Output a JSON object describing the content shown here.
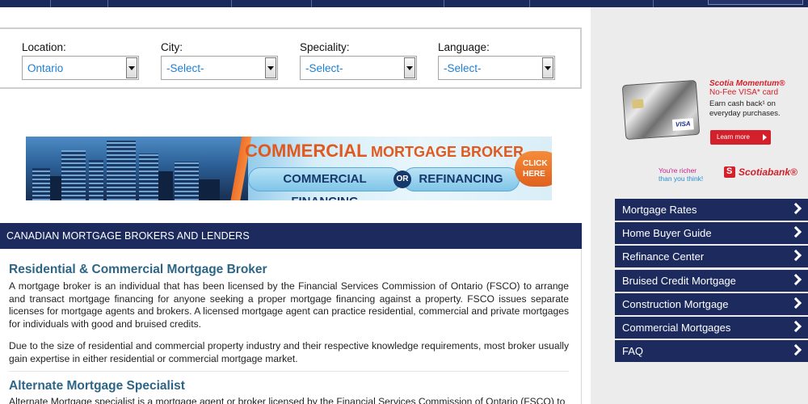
{
  "filters": {
    "location": {
      "label": "Location:",
      "value": "Ontario"
    },
    "city": {
      "label": "City:",
      "value": "-Select-"
    },
    "speciality": {
      "label": "Speciality:",
      "value": "-Select-"
    },
    "language": {
      "label": "Language:",
      "value": "-Select-"
    }
  },
  "banner": {
    "title_big": "COMMERCIAL",
    "title_small": "MORTGAGE BROKER",
    "left_pill": "COMMERCIAL FINANCING",
    "or": "OR",
    "right_pill": "REFINANCING",
    "cta_line1": "CLICK",
    "cta_line2": "HERE"
  },
  "section": {
    "title": "CANADIAN MORTGAGE BROKERS AND LENDERS"
  },
  "content": {
    "h1": "Residential & Commercial Mortgage Broker",
    "p1": "A mortgage broker is an individual that has been licensed by the Financial Services Commission of Ontario (FSCO) to arrange and transact mortgage financing for anyone seeking a proper mortgage financing against a property. FSCO issues separate licenses for mortgage agents and brokers. A licensed mortgage agent can practice residential, commercial and private mortgages for individuals with good and bruised credits.",
    "p2": "Due to the size of residential and commercial property industry and their respective knowledge requirements, most broker usually gain expertise in either residential or commercial mortgage market.",
    "h2": "Alternate Mortgage Specialist",
    "p3": "Alternate Mortgage specialist is a mortgage agent or broker licensed by the Financial Services Commission of Ontario (FSCO) to"
  },
  "ad": {
    "product_line1": "Scotia Momentum®",
    "product_line2": "No-Fee VISA* card",
    "pitch": "Earn cash back¹ on everyday purchases.",
    "button": "Learn more",
    "card_brand": "VISA",
    "tagline_a": "You're richer",
    "tagline_b": "than you think!",
    "bank": "Scotiabank®"
  },
  "side_menu": [
    {
      "label": "Mortgage Rates"
    },
    {
      "label": "Home Buyer Guide"
    },
    {
      "label": "Refinance Center"
    },
    {
      "label": "Bruised Credit Mortgage"
    },
    {
      "label": "Construction Mortgage"
    },
    {
      "label": "Commercial Mortgages"
    },
    {
      "label": "FAQ"
    }
  ],
  "colors": {
    "nav_navy": "#1c2a5e",
    "heading_blue": "#2d6586",
    "select_text": "#1d7fd1",
    "brand_red": "#d3202a",
    "banner_orange": "#e05a1f"
  }
}
